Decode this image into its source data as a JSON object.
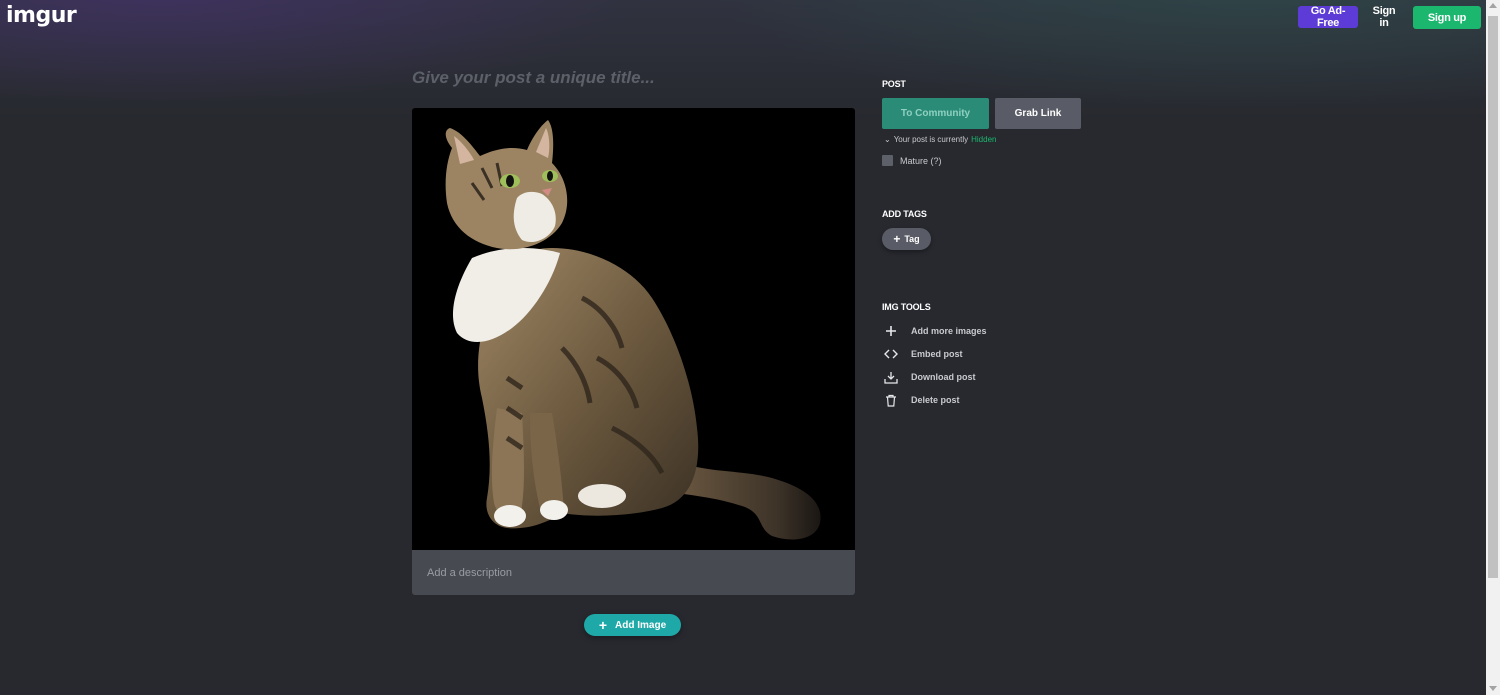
{
  "header": {
    "logo": "imgur",
    "go_ad_free": "Go Ad-Free",
    "sign_in": "Sign in",
    "sign_up": "Sign up"
  },
  "post_editor": {
    "title_placeholder": "Give your post a unique title...",
    "description_placeholder": "Add a description",
    "add_image_label": "Add Image",
    "image_icon": "cat-photo"
  },
  "sidebar": {
    "post": {
      "section_title": "POST",
      "to_community_label": "To Community",
      "grab_link_label": "Grab Link",
      "status_prefix": "Your post is currently",
      "status_value": "Hidden",
      "mature_label": "Mature (?)",
      "mature_checked": false
    },
    "tags": {
      "section_title": "ADD TAGS",
      "tag_button_label": "Tag"
    },
    "tools": {
      "section_title": "IMG TOOLS",
      "items": [
        {
          "label": "Add more images",
          "icon": "plus-icon"
        },
        {
          "label": "Embed post",
          "icon": "code-icon"
        },
        {
          "label": "Download post",
          "icon": "download-icon"
        },
        {
          "label": "Delete post",
          "icon": "trash-icon"
        }
      ]
    }
  },
  "colors": {
    "background": "#27292f",
    "go_ad_free": "#5c3bd6",
    "sign_up": "#1bb76e",
    "to_community": "#2a8c77",
    "grab_link": "#595c66",
    "add_image": "#1fa8a8",
    "hidden_status": "#1bb76e"
  }
}
